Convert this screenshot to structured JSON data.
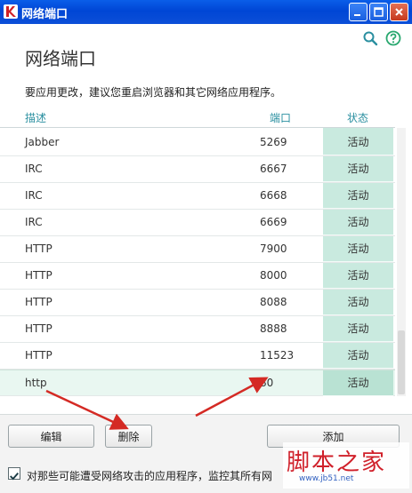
{
  "window": {
    "title": "网络端口",
    "app_icon": "kaspersky-k-icon"
  },
  "header_icons": [
    "search-icon",
    "help-icon"
  ],
  "heading": "网络端口",
  "notice": "要应用更改，建议您重启浏览器和其它网络应用程序。",
  "table": {
    "columns": {
      "description": "描述",
      "port": "端口",
      "status": "状态"
    },
    "rows": [
      {
        "description": "Jabber",
        "port": "5269",
        "status": "活动"
      },
      {
        "description": "IRC",
        "port": "6667",
        "status": "活动"
      },
      {
        "description": "IRC",
        "port": "6668",
        "status": "活动"
      },
      {
        "description": "IRC",
        "port": "6669",
        "status": "活动"
      },
      {
        "description": "HTTP",
        "port": "7900",
        "status": "活动"
      },
      {
        "description": "HTTP",
        "port": "8000",
        "status": "活动"
      },
      {
        "description": "HTTP",
        "port": "8088",
        "status": "活动"
      },
      {
        "description": "HTTP",
        "port": "8888",
        "status": "活动"
      },
      {
        "description": "HTTP",
        "port": "11523",
        "status": "活动"
      },
      {
        "description": "http",
        "port": "80",
        "status": "活动",
        "selected": true
      }
    ]
  },
  "buttons": {
    "edit": "编辑",
    "delete": "删除",
    "add": "添加"
  },
  "checkbox": {
    "checked": true,
    "label": "对那些可能遭受网络攻击的应用程序，监控其所有网"
  },
  "watermark": {
    "text": "脚本之家",
    "url": "www.jb51.net"
  },
  "colors": {
    "titlebar": "#0046d5",
    "status_cell": "#c9eadf",
    "column_header": "#2a8fa0",
    "arrow": "#d42a24"
  }
}
